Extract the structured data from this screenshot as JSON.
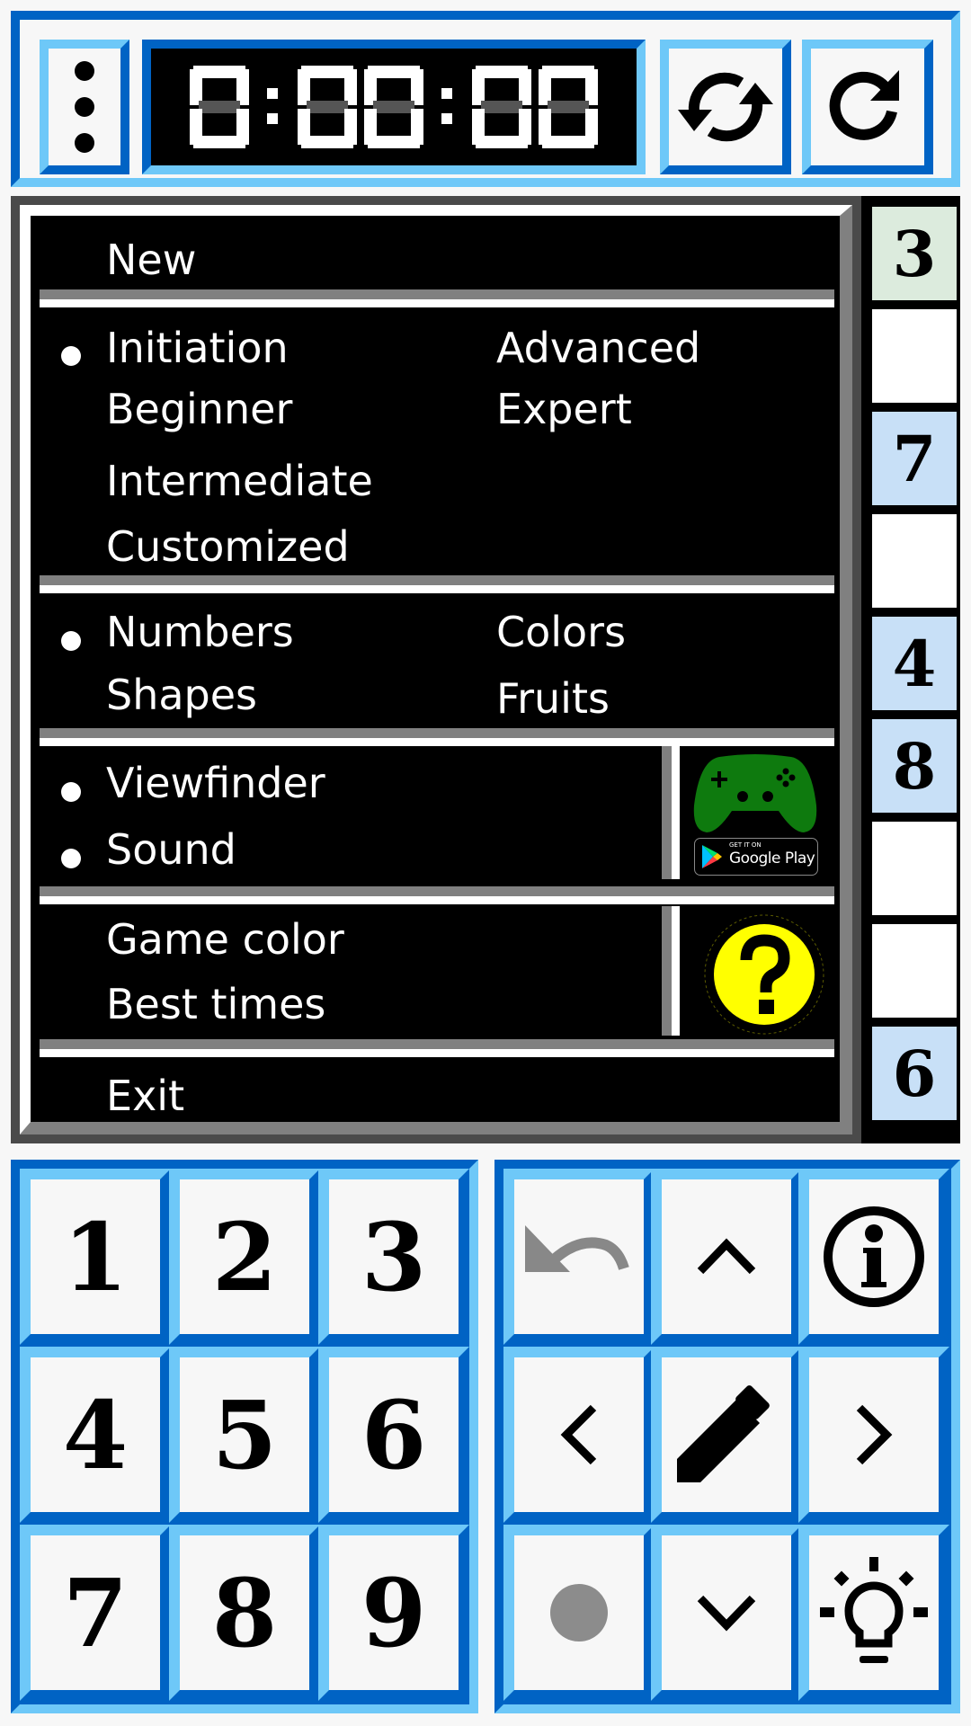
{
  "header": {
    "timer_value": "8:88:88",
    "menu_icon": "more-vertical-icon",
    "shuffle_icon": "sync-icon",
    "restart_icon": "redo-icon"
  },
  "board": {
    "visible_column": [
      {
        "value": "3",
        "bg": "#dcebdd"
      },
      {
        "value": "",
        "bg": "#ffffff"
      },
      {
        "value": "7",
        "bg": "#c8e0f7"
      },
      {
        "value": "",
        "bg": "#ffffff"
      },
      {
        "value": "4",
        "bg": "#c8e0f7"
      },
      {
        "value": "8",
        "bg": "#c8e0f7"
      },
      {
        "value": "",
        "bg": "#ffffff"
      },
      {
        "value": "",
        "bg": "#ffffff"
      },
      {
        "value": "6",
        "bg": "#c8e0f7"
      }
    ]
  },
  "menu": {
    "new": "New",
    "levels": [
      {
        "label": "Initiation",
        "selected": true
      },
      {
        "label": "Beginner",
        "selected": false
      },
      {
        "label": "Intermediate",
        "selected": false
      },
      {
        "label": "Customized",
        "selected": false
      },
      {
        "label": "Advanced",
        "selected": false
      },
      {
        "label": "Expert",
        "selected": false
      }
    ],
    "symbols": [
      {
        "label": "Numbers",
        "selected": true
      },
      {
        "label": "Shapes",
        "selected": false
      },
      {
        "label": "Colors",
        "selected": false
      },
      {
        "label": "Fruits",
        "selected": false
      }
    ],
    "toggles": [
      {
        "label": "Viewfinder",
        "checked": true
      },
      {
        "label": "Sound",
        "checked": true
      }
    ],
    "game_color": "Game color",
    "best_times": "Best times",
    "exit": "Exit",
    "play_badge": {
      "small": "GET IT ON",
      "large": "Google Play"
    },
    "colors": {
      "gamepad": "#0e7a0e",
      "help": "#ffff00"
    }
  },
  "numpad": {
    "keys": [
      "1",
      "2",
      "3",
      "4",
      "5",
      "6",
      "7",
      "8",
      "9"
    ]
  },
  "toolpad": {
    "keys": [
      {
        "icon": "undo-icon",
        "name": "undo-button"
      },
      {
        "icon": "chevron-up-icon",
        "name": "up-button"
      },
      {
        "icon": "info-icon",
        "name": "info-button"
      },
      {
        "icon": "chevron-left-icon",
        "name": "left-button"
      },
      {
        "icon": "pencil-icon",
        "name": "pencil-button"
      },
      {
        "icon": "chevron-right-icon",
        "name": "right-button"
      },
      {
        "icon": "dot-icon",
        "name": "clear-button"
      },
      {
        "icon": "chevron-down-icon",
        "name": "down-button"
      },
      {
        "icon": "lightbulb-icon",
        "name": "hint-button"
      }
    ]
  },
  "theme": {
    "blue_dark": "#0063c4",
    "blue_light": "#6ec8f8",
    "key_bg": "#f7f7f7"
  }
}
